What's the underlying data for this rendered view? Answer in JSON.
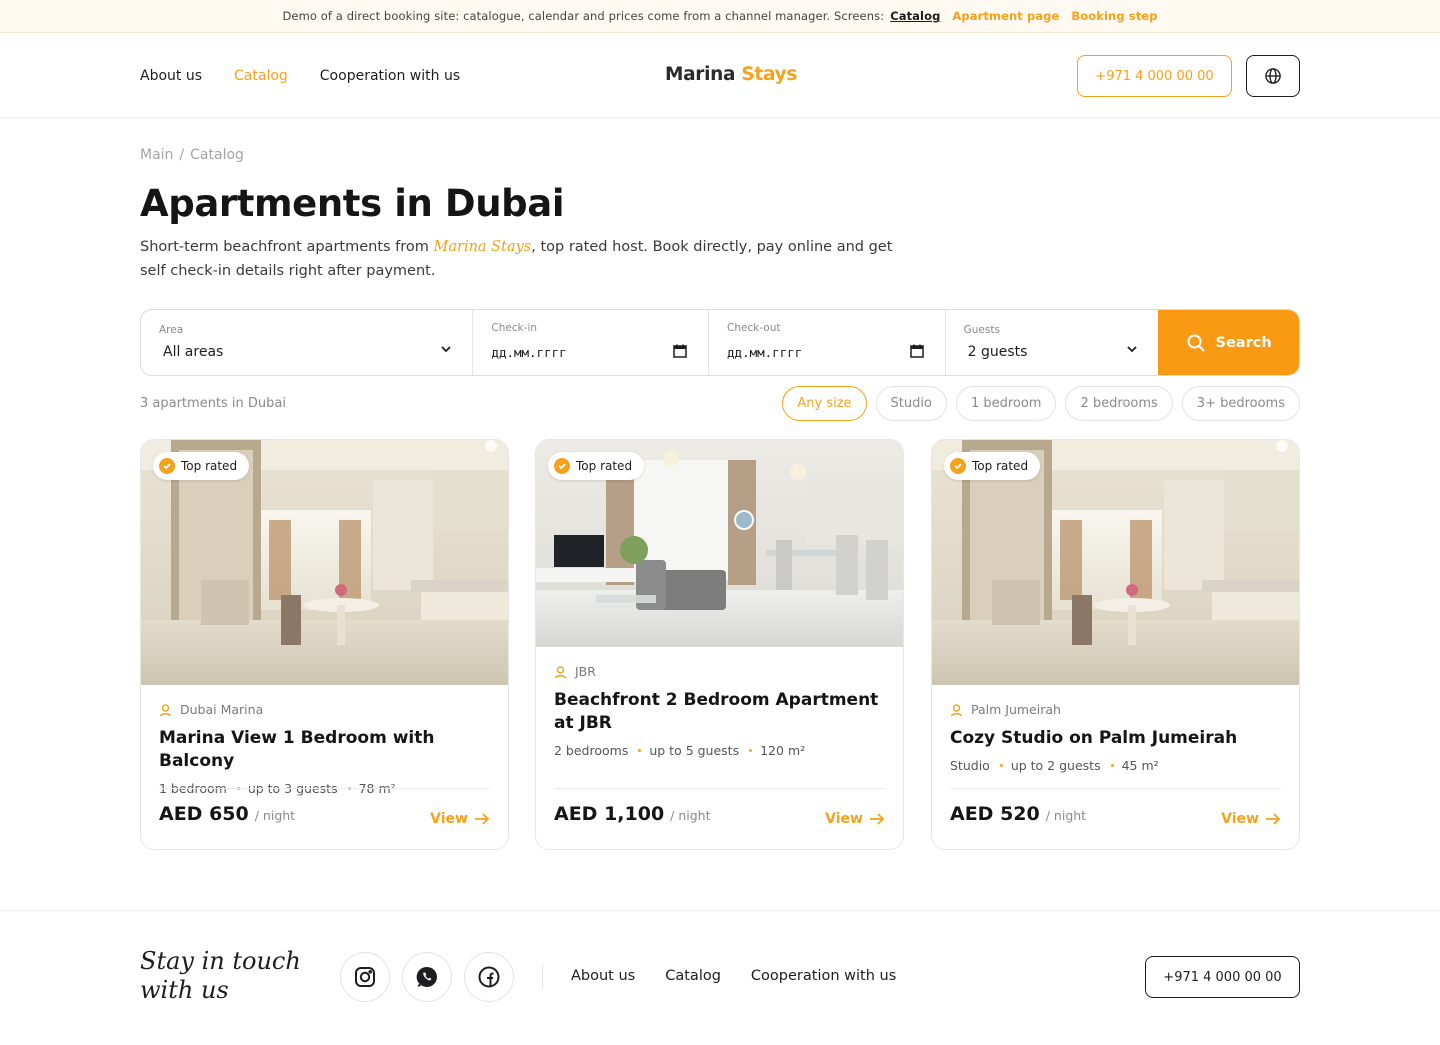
{
  "demo_bar": {
    "text": "Demo of a direct booking site: catalogue, calendar and prices come from a channel manager. Screens:",
    "links": [
      "Catalog",
      "Apartment page",
      "Booking step"
    ]
  },
  "header": {
    "nav": [
      "About us",
      "Catalog",
      "Cooperation with us"
    ],
    "logo_part1": "Marina",
    "logo_part2": "Stays",
    "phone": "+971 4 000 00 00",
    "lang_icon": "globe-icon"
  },
  "breadcrumb": [
    "Main",
    "Catalog"
  ],
  "page": {
    "title": "Apartments in Dubai",
    "subtitle_before": "Short-term beachfront apartments from ",
    "subtitle_brand": "Marina Stays",
    "subtitle_after": ", top rated host. Book directly, pay online and get self check-in details right after payment."
  },
  "search": {
    "area_label": "Area",
    "area_value": "All areas",
    "checkin_label": "Check-in",
    "checkin_value": "дд.мм.гггг",
    "checkout_label": "Check-out",
    "checkout_value": "дд.мм.гггг",
    "guests_label": "Guests",
    "guests_value": "2 guests",
    "button": "Search"
  },
  "results": {
    "count": "3 apartments in Dubai",
    "filters": [
      "Any size",
      "Studio",
      "1 bedroom",
      "2 bedrooms",
      "3+ bedrooms"
    ]
  },
  "listings": [
    {
      "badge": "Top rated",
      "location": "Dubai Marina",
      "name": "Marina View 1 Bedroom with Balcony",
      "rooms": "1 bedroom",
      "guests": "up to 3 guests",
      "area": "78 m²",
      "price": "AED 650",
      "per": "/ night",
      "action": "View"
    },
    {
      "badge": "Top rated",
      "location": "JBR",
      "name": "Beachfront 2 Bedroom Apartment at JBR",
      "rooms": "2 bedrooms",
      "guests": "up to 5 guests",
      "area": "120 m²",
      "price": "AED 1,100",
      "per": "/ night",
      "action": "View"
    },
    {
      "badge": "Top rated",
      "location": "Palm Jumeirah",
      "name": "Cozy Studio on Palm Jumeirah",
      "rooms": "Studio",
      "guests": "up to 2 guests",
      "area": "45 m²",
      "price": "AED 520",
      "per": "/ night",
      "action": "View"
    }
  ],
  "footer": {
    "tagline_line1": "Stay in touch",
    "tagline_line2": "with us",
    "social_icons": [
      "instagram-icon",
      "whatsapp-icon",
      "facebook-icon"
    ],
    "nav": [
      "About us",
      "Catalog",
      "Cooperation with us"
    ],
    "phone": "+971 4 000 00 00"
  },
  "colors": {
    "accent": "#f4a21b",
    "search_button": "#f99a12",
    "text": "#1d1d1f"
  }
}
